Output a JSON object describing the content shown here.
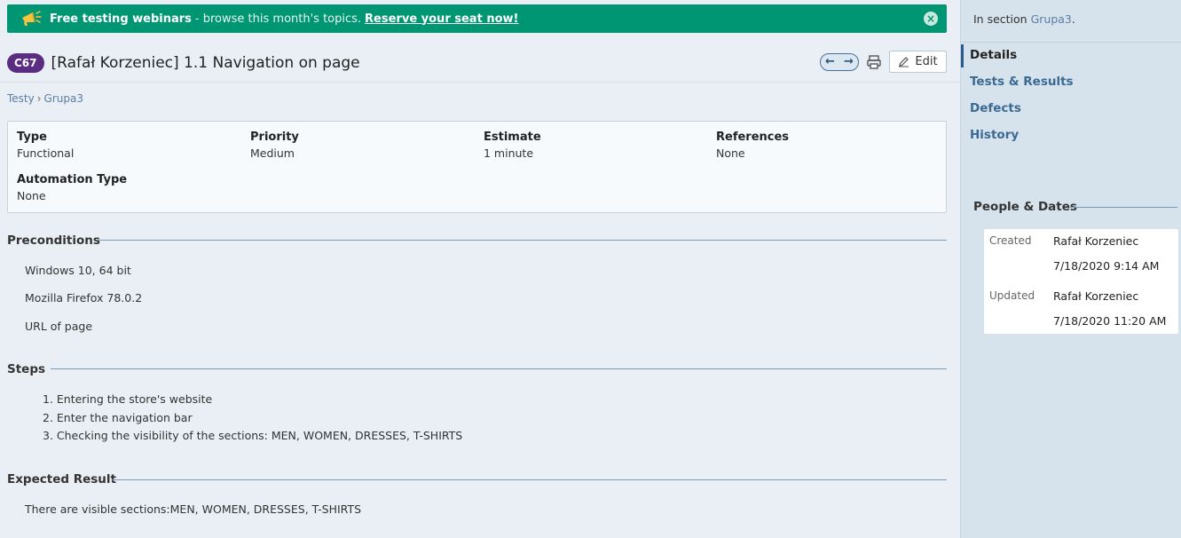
{
  "banner": {
    "bold_text": "Free testing webinars",
    "rest_text": "- browse this month's topics.",
    "link_text": "Reserve your seat now!",
    "close_icon": "×"
  },
  "header": {
    "badge": "C67",
    "title": "[Rafał Korzeniec] 1.1 Navigation on page",
    "edit_label": "Edit"
  },
  "breadcrumb": {
    "items": [
      "Testy",
      "Grupa3"
    ],
    "separator": "›"
  },
  "fields": {
    "type": {
      "label": "Type",
      "value": "Functional"
    },
    "priority": {
      "label": "Priority",
      "value": "Medium"
    },
    "estimate": {
      "label": "Estimate",
      "value": "1 minute"
    },
    "references": {
      "label": "References",
      "value": "None"
    },
    "automation": {
      "label": "Automation Type",
      "value": "None"
    }
  },
  "preconditions": {
    "title": "Preconditions",
    "items": [
      "Windows 10, 64 bit",
      "Mozilla Firefox 78.0.2",
      "URL of page"
    ]
  },
  "steps": {
    "title": "Steps",
    "items": [
      "1. Entering the store's website",
      "2. Enter the navigation bar",
      "3. Checking the visibility of the sections: MEN, WOMEN, DRESSES, T-SHIRTS"
    ]
  },
  "expected": {
    "title": "Expected Result",
    "text": "There are visible sections:MEN, WOMEN, DRESSES, T-SHIRTS"
  },
  "sidebar": {
    "in_section_prefix": "In section ",
    "in_section_link": "Grupa3",
    "in_section_suffix": ".",
    "nav": [
      "Details",
      "Tests & Results",
      "Defects",
      "History"
    ],
    "people_dates_title": "People & Dates",
    "created_label": "Created",
    "created_by": "Rafał Korzeniec",
    "created_at": "7/18/2020 9:14 AM",
    "updated_label": "Updated",
    "updated_by": "Rafał Korzeniec",
    "updated_at": "7/18/2020 11:20 AM"
  },
  "colors": {
    "banner": "#009673",
    "badge": "#5b2d82",
    "link": "#5a7fa5"
  }
}
